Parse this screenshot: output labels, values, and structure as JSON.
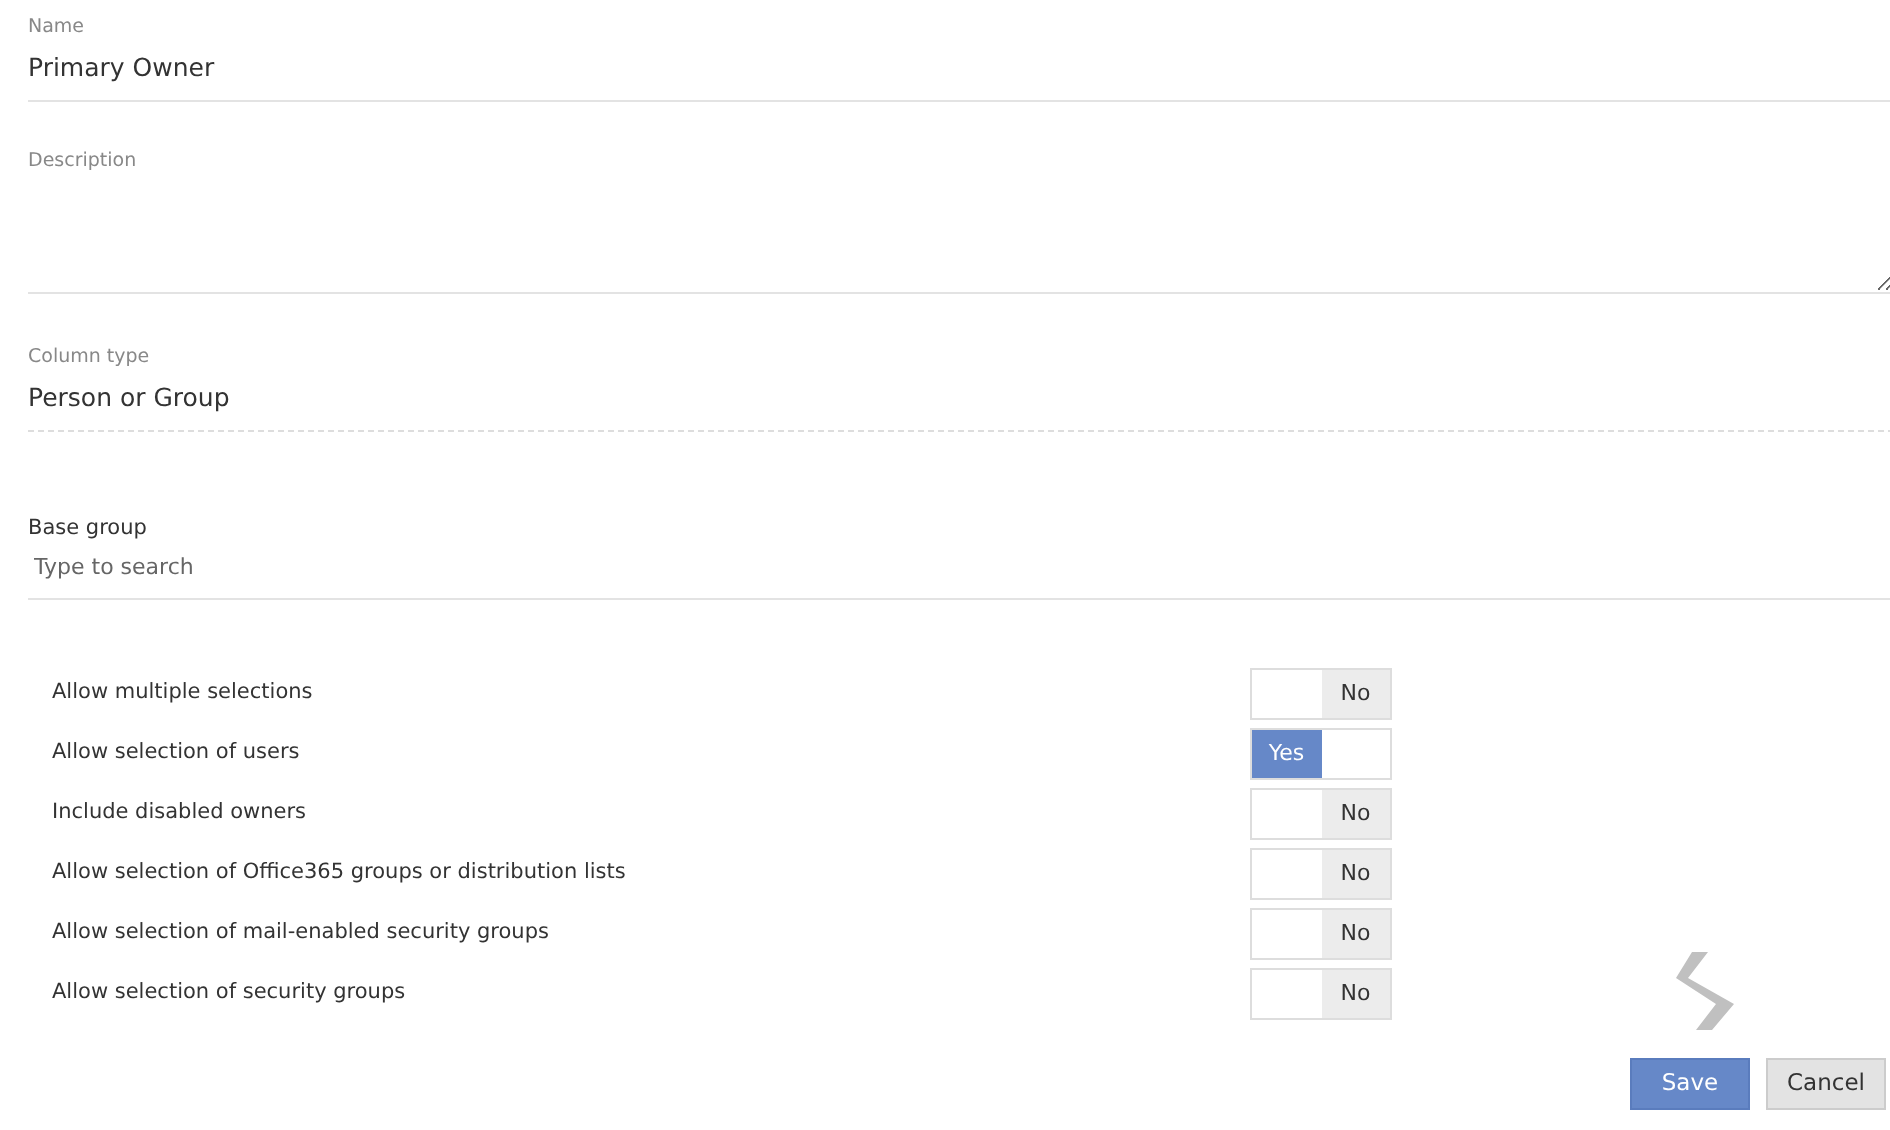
{
  "name_field": {
    "label": "Name",
    "value": "Primary Owner"
  },
  "description_field": {
    "label": "Description"
  },
  "column_type": {
    "label": "Column type",
    "value": "Person or Group"
  },
  "base_group": {
    "label": "Base group",
    "placeholder": "Type to search"
  },
  "options": [
    {
      "label": "Allow multiple selections",
      "on": false,
      "text": "No"
    },
    {
      "label": "Allow selection of users",
      "on": true,
      "text": "Yes"
    },
    {
      "label": "Include disabled owners",
      "on": false,
      "text": "No"
    },
    {
      "label": "Allow selection of Office365 groups or distribution lists",
      "on": false,
      "text": "No"
    },
    {
      "label": "Allow selection of mail-enabled security groups",
      "on": false,
      "text": "No"
    },
    {
      "label": "Allow selection of security groups",
      "on": false,
      "text": "No"
    }
  ],
  "buttons": [
    {
      "label": "Save",
      "kind": "primary"
    },
    {
      "label": "Cancel",
      "kind": "secondary"
    }
  ]
}
